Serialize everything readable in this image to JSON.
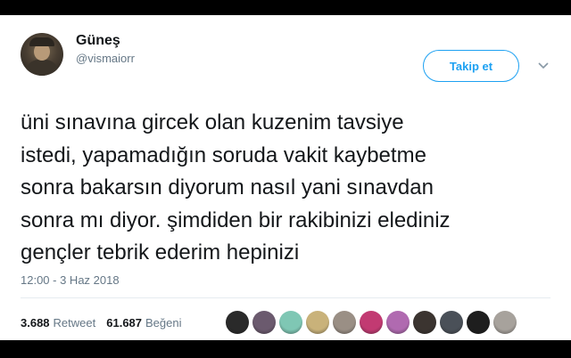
{
  "user": {
    "name": "Güneş",
    "handle": "@vismaiorr"
  },
  "follow_label": "Takip et",
  "tweet": {
    "text": "üni sınavına gircek olan kuzenim tavsiye\nistedi, yapamadığın soruda vakit kaybetme\nsonra bakarsın diyorum nasıl yani sınavdan\nsonra mı diyor. şimdiden bir rakibinizi elediniz\ngençler tebrik ederim hepinizi",
    "timestamp": "12:00 - 3 Haz 2018"
  },
  "stats": {
    "retweets": "3.688",
    "retweets_label": "Retweet",
    "likes": "61.687",
    "likes_label": "Beğeni"
  },
  "likers": [
    {
      "icon": "liker-avatar",
      "color": "#2a2a2a"
    },
    {
      "icon": "liker-avatar",
      "color": "#6b5a6e"
    },
    {
      "icon": "liker-avatar",
      "color": "#7fc7b4"
    },
    {
      "icon": "liker-avatar",
      "color": "#c9b27a"
    },
    {
      "icon": "liker-avatar",
      "color": "#9a8f85"
    },
    {
      "icon": "liker-avatar",
      "color": "#c23a72"
    },
    {
      "icon": "liker-avatar",
      "color": "#b06ab0"
    },
    {
      "icon": "liker-avatar",
      "color": "#3b3430"
    },
    {
      "icon": "liker-avatar",
      "color": "#4a5058"
    },
    {
      "icon": "liker-avatar",
      "color": "#1e1e1e"
    },
    {
      "icon": "liker-avatar",
      "color": "#a7a29c"
    }
  ],
  "colors": {
    "accent": "#1da1f2",
    "text": "#14171a",
    "muted": "#657786"
  }
}
